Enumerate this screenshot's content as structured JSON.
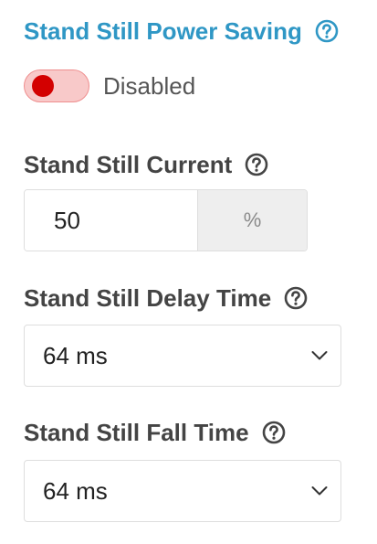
{
  "power_saving": {
    "title": "Stand Still Power Saving",
    "toggle_label": "Disabled",
    "toggle_state": "off"
  },
  "current": {
    "label": "Stand Still Current",
    "value": "50",
    "unit": "%"
  },
  "delay_time": {
    "label": "Stand Still Delay Time",
    "value": "64 ms"
  },
  "fall_time": {
    "label": "Stand Still Fall Time",
    "value": "64 ms"
  },
  "colors": {
    "title_accent": "#2f97c5",
    "toggle_track": "#f8c9c9",
    "toggle_border": "#ef8f8f",
    "toggle_knob": "#d30000"
  },
  "icons": {
    "help": "question-circle-icon",
    "dropdown": "chevron-down-icon"
  }
}
